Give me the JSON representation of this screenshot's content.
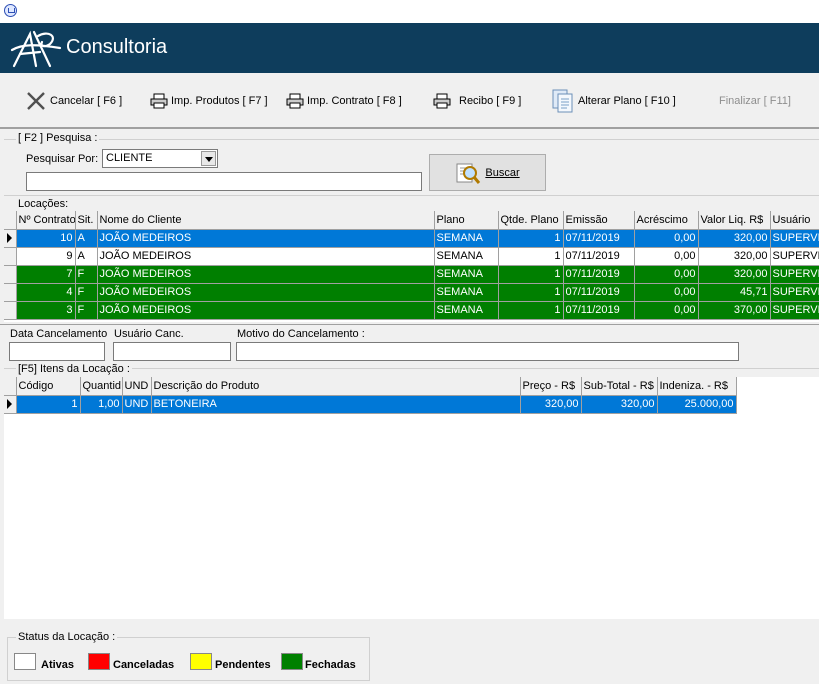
{
  "header": {
    "title": "Consultoria"
  },
  "colors": {
    "banner": "#0e3d5c",
    "selected_row": "#0078d7",
    "closed_row": "#007f00"
  },
  "toolbar": {
    "cancelar": "Cancelar [ F6 ]",
    "imp_produtos": "Imp. Produtos  [ F7 ]",
    "imp_contrato": "Imp. Contrato  [ F8 ]",
    "recibo": "Recibo  [ F9 ]",
    "alterar_plano": "Alterar Plano [ F10 ]",
    "finalizar": "Finalizar  [ F11]"
  },
  "search": {
    "group_label": "[ F2 ]  Pesquisa :",
    "by_label": "Pesquisar Por:",
    "by_value": "CLIENTE",
    "text_value": "",
    "button_label": "Buscar"
  },
  "locacoes": {
    "label": "Locações:",
    "columns": [
      "Nº Contrato",
      "Sit.",
      "Nome do Cliente",
      "Plano",
      "Qtde. Plano",
      "Emissão",
      "Acréscimo",
      "Valor Liq. R$",
      "Usuário"
    ],
    "rows": [
      {
        "contrato": "10",
        "sit": "A",
        "cliente": "JOÃO MEDEIROS",
        "plano": "SEMANA",
        "qtde": "1",
        "emissao": "07/11/2019",
        "acrescimo": "0,00",
        "valor": "320,00",
        "usuario": "SUPERVI",
        "style": "sel"
      },
      {
        "contrato": "9",
        "sit": "A",
        "cliente": "JOÃO MEDEIROS",
        "plano": "SEMANA",
        "qtde": "1",
        "emissao": "07/11/2019",
        "acrescimo": "0,00",
        "valor": "320,00",
        "usuario": "SUPERVI",
        "style": "white"
      },
      {
        "contrato": "7",
        "sit": "F",
        "cliente": "JOÃO MEDEIROS",
        "plano": "SEMANA",
        "qtde": "1",
        "emissao": "07/11/2019",
        "acrescimo": "0,00",
        "valor": "320,00",
        "usuario": "SUPERVI",
        "style": "green"
      },
      {
        "contrato": "4",
        "sit": "F",
        "cliente": "JOÃO MEDEIROS",
        "plano": "SEMANA",
        "qtde": "1",
        "emissao": "07/11/2019",
        "acrescimo": "0,00",
        "valor": "45,71",
        "usuario": "SUPERVI",
        "style": "green"
      },
      {
        "contrato": "3",
        "sit": "F",
        "cliente": "JOÃO MEDEIROS",
        "plano": "SEMANA",
        "qtde": "1",
        "emissao": "07/11/2019",
        "acrescimo": "0,00",
        "valor": "370,00",
        "usuario": "SUPERVI",
        "style": "green"
      }
    ]
  },
  "cancel": {
    "data_label": "Data Cancelamento",
    "usuario_label": "Usuário Canc.",
    "motivo_label": "Motivo do Cancelamento  :",
    "data_value": "",
    "usuario_value": "",
    "motivo_value": ""
  },
  "itens": {
    "label": "[F5]  Itens da Locação  :",
    "columns": [
      "Código",
      "Quantid",
      "UND",
      "Descrição do Produto",
      "Preço - R$",
      "Sub-Total - R$",
      "Indeniza. - R$"
    ],
    "rows": [
      {
        "codigo": "1",
        "quantidade": "1,00",
        "und": "UND",
        "descricao": "BETONEIRA",
        "preco": "320,00",
        "subtotal": "320,00",
        "indenizacao": "25.000,00"
      }
    ]
  },
  "status": {
    "label": "Status da Locação :",
    "items": [
      {
        "label": "Ativas",
        "color": "#ffffff"
      },
      {
        "label": "Canceladas",
        "color": "#ff0000"
      },
      {
        "label": "Pendentes",
        "color": "#ffff00"
      },
      {
        "label": "Fechadas",
        "color": "#008000"
      }
    ]
  }
}
